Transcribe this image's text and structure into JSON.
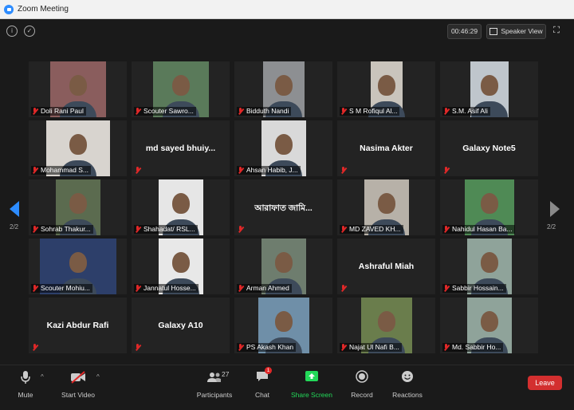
{
  "window": {
    "title": "Zoom Meeting"
  },
  "top": {
    "timer": "00:46:29",
    "view_label": "Speaker View"
  },
  "pager": {
    "left": "2/2",
    "right": "2/2"
  },
  "tiles": [
    {
      "name": "Doli Rani Paul",
      "video": true,
      "bg": "#8a5d5d"
    },
    {
      "name": "Scouter Sawro...",
      "video": true,
      "bg": "#5a7a5a"
    },
    {
      "name": "Bidduth Nandi",
      "video": true,
      "bg": "#8d8f92"
    },
    {
      "name": "S M Rofiqul Al...",
      "video": true,
      "bg": "#c9c4bc"
    },
    {
      "name": "S.M. Asif Ali",
      "video": true,
      "bg": "#bfc6cc"
    },
    {
      "name": "Mohammad S...",
      "video": true,
      "bg": "#d8d4cf"
    },
    {
      "name": "md sayed bhuiy...",
      "video": false
    },
    {
      "name": "Ahsan Habib, J...",
      "video": true,
      "bg": "#d9d9d9"
    },
    {
      "name": "Nasima Akter",
      "video": false
    },
    {
      "name": "Galaxy Note5",
      "video": false
    },
    {
      "name": "Sohrab Thakur...",
      "video": true,
      "bg": "#5b6b4f"
    },
    {
      "name": "Shahadat/ RSL...",
      "video": true,
      "bg": "#e6e6e6"
    },
    {
      "name": "আরাফাত জামি...",
      "video": false
    },
    {
      "name": "MD ZAVED KH...",
      "video": true,
      "bg": "#b7b1a8"
    },
    {
      "name": "Nahidul Hasan Ba...",
      "video": true,
      "bg": "#4f8a55"
    },
    {
      "name": "Scouter Mohiu...",
      "video": true,
      "bg": "#2d3f6a"
    },
    {
      "name": "Jannatul Hosse...",
      "video": true,
      "bg": "#e8e8e8"
    },
    {
      "name": "Arman Ahmed",
      "video": true,
      "bg": "#6e7d6e"
    },
    {
      "name": "Ashraful Miah",
      "video": false
    },
    {
      "name": "Sabbir Hossain...",
      "video": true,
      "bg": "#8fa39a"
    },
    {
      "name": "Kazi Abdur Rafi",
      "video": false
    },
    {
      "name": "Galaxy A10",
      "video": false
    },
    {
      "name": "PS Akash Khan",
      "video": true,
      "bg": "#6f8fa8"
    },
    {
      "name": "Najat Ul Nafi B...",
      "video": true,
      "bg": "#6a7d4c"
    },
    {
      "name": "Md. Sabbir Ho...",
      "video": true,
      "bg": "#8fa39a"
    }
  ],
  "toolbar": {
    "mute": "Mute",
    "start_video": "Start Video",
    "participants": "Participants",
    "participants_count": "27",
    "chat": "Chat",
    "chat_badge": "1",
    "share_screen": "Share Screen",
    "record": "Record",
    "reactions": "Reactions",
    "leave": "Leave"
  },
  "colors": {
    "accent": "#2d8cff",
    "share": "#23d959",
    "leave": "#d32f2f",
    "muted": "#e02828"
  }
}
